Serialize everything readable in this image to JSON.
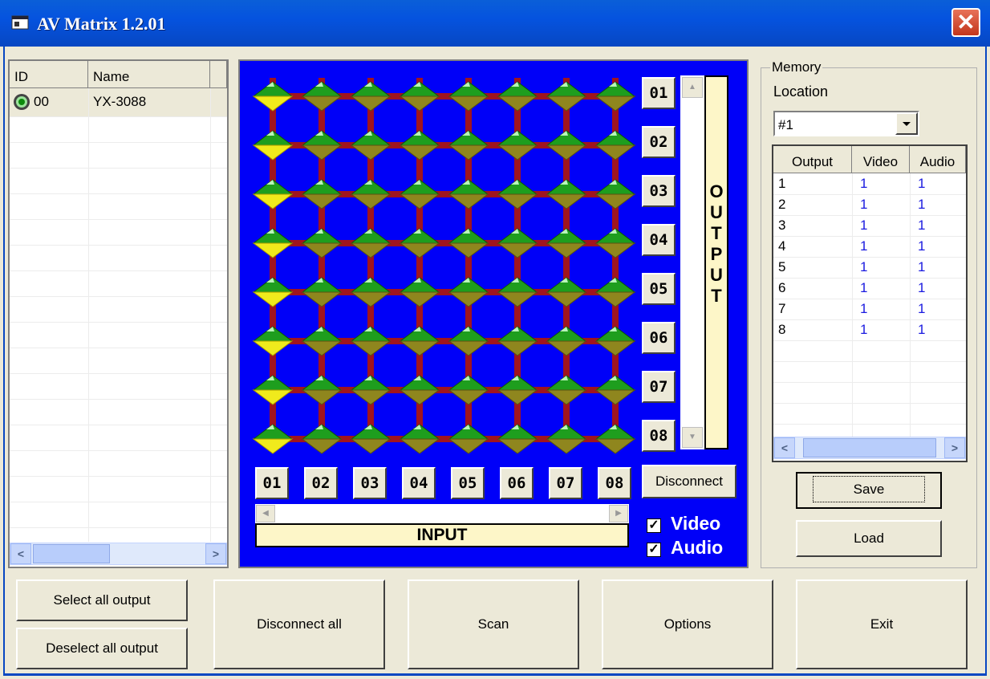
{
  "window": {
    "title": "AV Matrix 1.2.01",
    "close_glyph": "✕"
  },
  "device_list": {
    "columns": [
      "ID",
      "Name"
    ],
    "rows": [
      {
        "id": "00",
        "name": "YX-3088",
        "status_icon": "connected-led-icon"
      }
    ]
  },
  "matrix": {
    "outputs": [
      "01",
      "02",
      "03",
      "04",
      "05",
      "06",
      "07",
      "08"
    ],
    "inputs": [
      "01",
      "02",
      "03",
      "04",
      "05",
      "06",
      "07",
      "08"
    ],
    "output_label_letters": [
      "O",
      "U",
      "T",
      "P",
      "U",
      "T"
    ],
    "input_label": "INPUT",
    "disconnect_label": "Disconnect",
    "video_label": "Video",
    "audio_label": "Audio",
    "video_checked": true,
    "audio_checked": true,
    "connections": [
      1,
      1,
      1,
      1,
      1,
      1,
      1,
      1
    ],
    "colors": {
      "background": "#0000f8",
      "active_node": "#f0ea1c",
      "node_top": "#1e9e1e",
      "node_bottom": "#8f861e",
      "grid_line": "#a0141e"
    }
  },
  "memory": {
    "group_label": "Memory",
    "location_label": "Location",
    "location_value": "#1",
    "columns": [
      "Output",
      "Video",
      "Audio"
    ],
    "rows": [
      {
        "output": "1",
        "video": "1",
        "audio": "1"
      },
      {
        "output": "2",
        "video": "1",
        "audio": "1"
      },
      {
        "output": "3",
        "video": "1",
        "audio": "1"
      },
      {
        "output": "4",
        "video": "1",
        "audio": "1"
      },
      {
        "output": "5",
        "video": "1",
        "audio": "1"
      },
      {
        "output": "6",
        "video": "1",
        "audio": "1"
      },
      {
        "output": "7",
        "video": "1",
        "audio": "1"
      },
      {
        "output": "8",
        "video": "1",
        "audio": "1"
      }
    ],
    "save_label": "Save",
    "load_label": "Load"
  },
  "buttons": {
    "select_all": "Select all output",
    "deselect_all": "Deselect all output",
    "disconnect_all": "Disconnect all",
    "scan": "Scan",
    "options": "Options",
    "exit": "Exit"
  }
}
